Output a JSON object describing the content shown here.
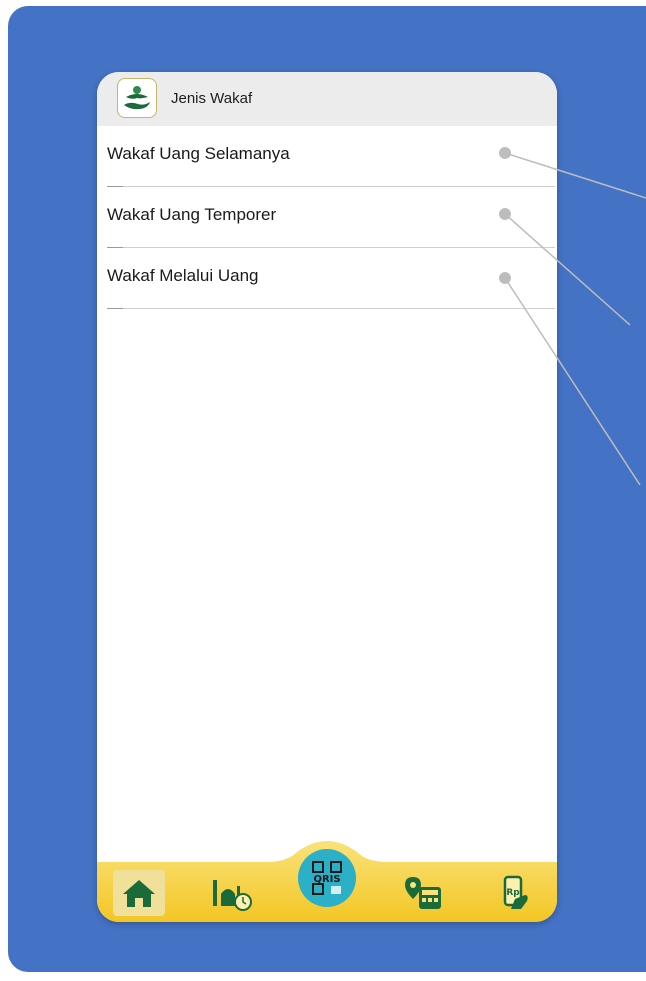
{
  "header": {
    "title": "Jenis Wakaf"
  },
  "list": {
    "items": [
      {
        "label": "Wakaf Uang Selamanya"
      },
      {
        "label": "Wakaf Uang Temporer"
      },
      {
        "label": "Wakaf Melalui Uang"
      }
    ]
  },
  "bottom_nav": {
    "qris_label": "QRIS",
    "icons": [
      "home-icon",
      "mosque-clock-icon",
      "qris-icon",
      "location-calculator-icon",
      "mobile-payment-icon"
    ]
  },
  "colors": {
    "backdrop": "#4472c4",
    "header_bg": "#ececec",
    "nav_gold": "#f3c623",
    "nav_gold_light": "#fae27a",
    "icon_green": "#1b6b3a",
    "qris_teal": "#2bb0c8"
  }
}
